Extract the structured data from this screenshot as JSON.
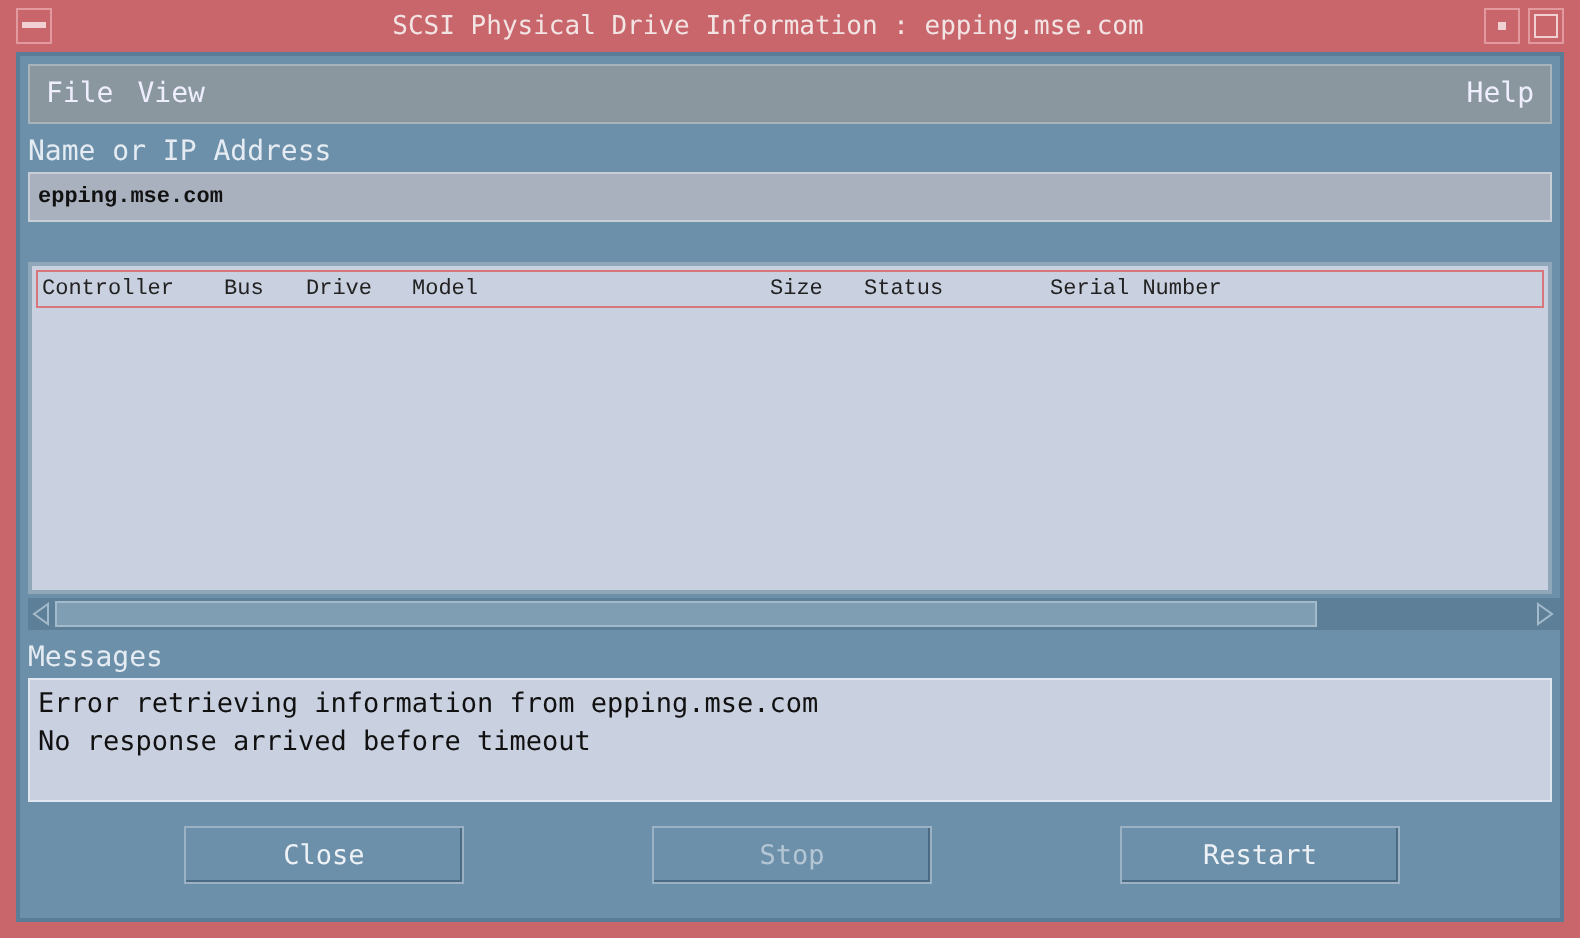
{
  "window": {
    "title": "SCSI Physical Drive Information : epping.mse.com"
  },
  "menu": {
    "left": [
      {
        "label": "File"
      },
      {
        "label": "View"
      }
    ],
    "right": [
      {
        "label": "Help"
      }
    ]
  },
  "address": {
    "label": "Name or IP Address",
    "value": "epping.mse.com"
  },
  "table": {
    "columns": [
      {
        "label": "Controller"
      },
      {
        "label": "Bus"
      },
      {
        "label": "Drive"
      },
      {
        "label": "Model"
      },
      {
        "label": "Size"
      },
      {
        "label": "Status"
      },
      {
        "label": "Serial Number"
      }
    ]
  },
  "messages": {
    "label": "Messages",
    "lines": [
      "Error retrieving information from epping.mse.com",
      "No response arrived before timeout"
    ]
  },
  "buttons": [
    {
      "label": "Close",
      "disabled": false
    },
    {
      "label": "Stop",
      "disabled": true
    },
    {
      "label": "Restart",
      "disabled": false
    }
  ]
}
